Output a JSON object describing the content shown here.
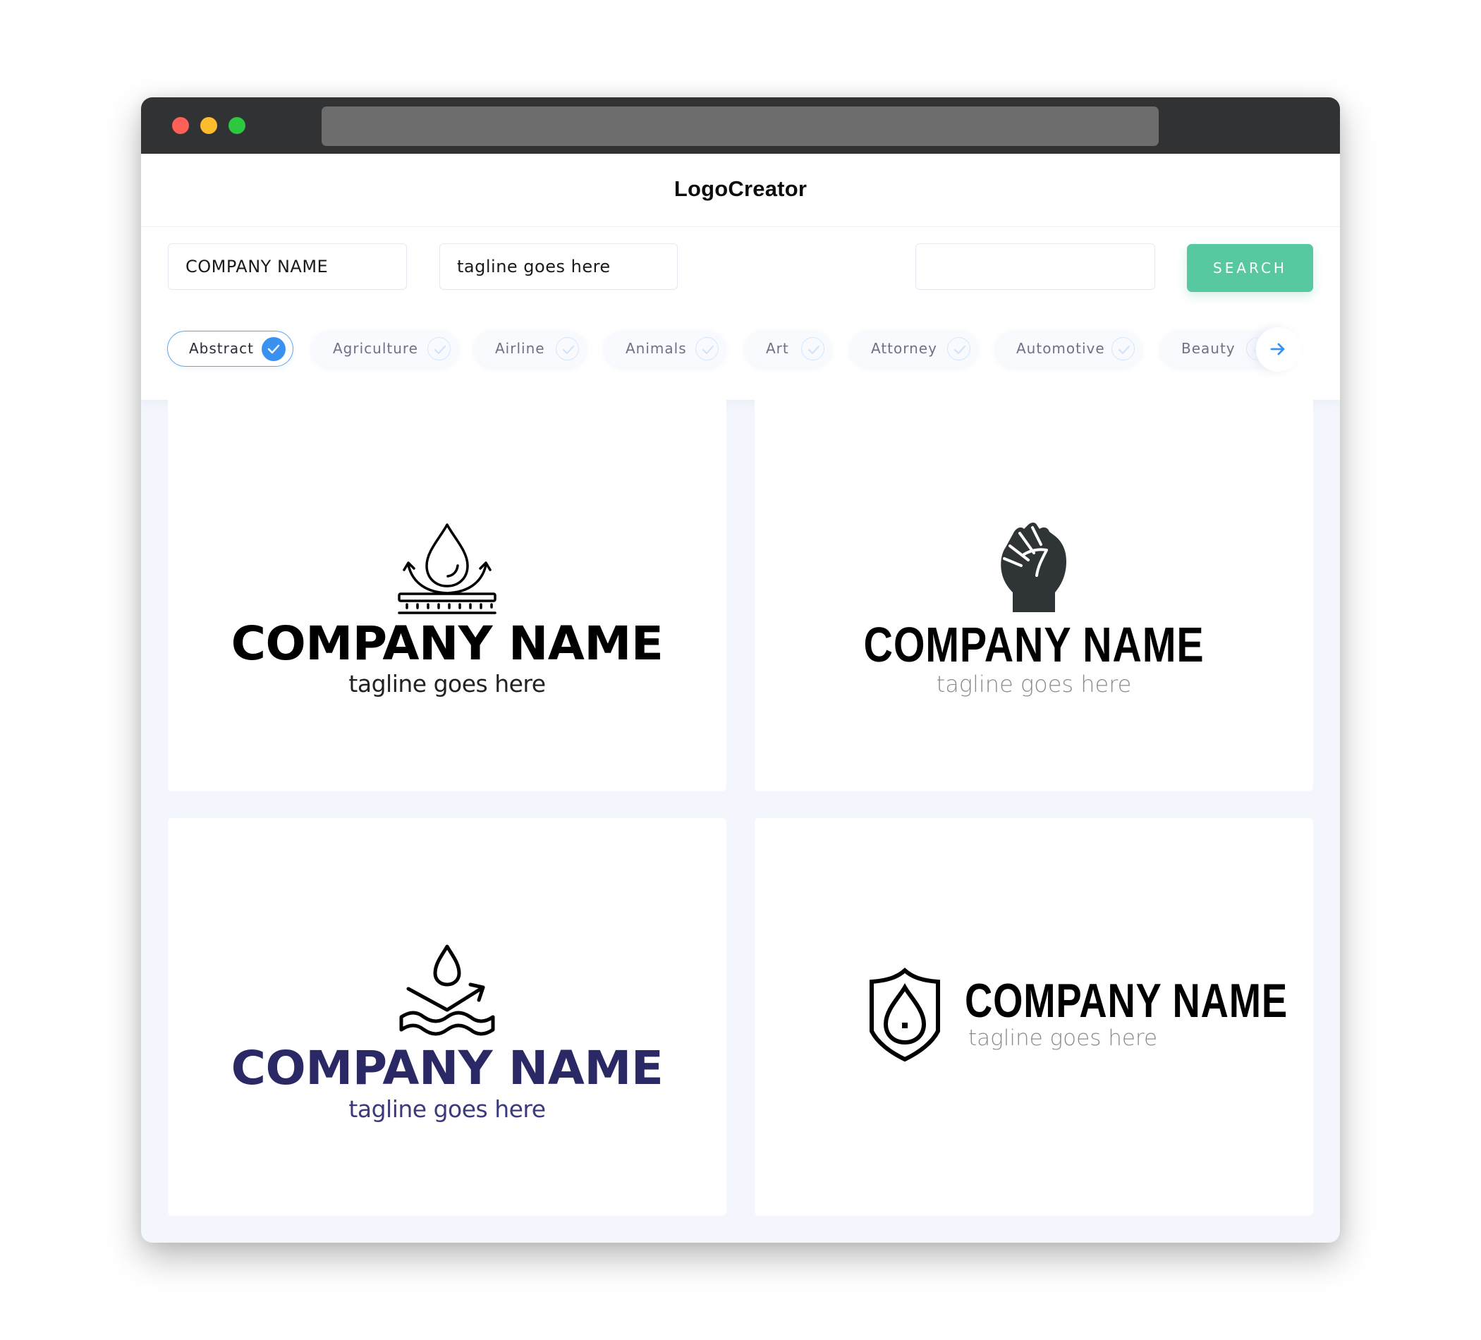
{
  "window": {
    "traffic_lights": [
      "close",
      "minimize",
      "maximize"
    ],
    "address_bar": ""
  },
  "header": {
    "brand": "LogoCreator"
  },
  "search": {
    "company_value": "COMPANY NAME",
    "tagline_value": "tagline goes here",
    "extra_value": "",
    "button_label": "SEARCH",
    "accent_color": "#58C8A0"
  },
  "categories": {
    "items": [
      {
        "label": "Abstract",
        "selected": true
      },
      {
        "label": "Agriculture",
        "selected": false
      },
      {
        "label": "Airline",
        "selected": false
      },
      {
        "label": "Animals",
        "selected": false
      },
      {
        "label": "Art",
        "selected": false
      },
      {
        "label": "Attorney",
        "selected": false
      },
      {
        "label": "Automotive",
        "selected": false
      },
      {
        "label": "Beauty",
        "selected": false
      }
    ],
    "next_icon": "arrow-right-icon",
    "selected_color": "#3A92F0"
  },
  "logos": [
    {
      "icon": "water-drop-repel-icon",
      "company": "COMPANY NAME",
      "tagline": "tagline goes here",
      "color": "#000000"
    },
    {
      "icon": "raised-fist-icon",
      "company": "COMPANY NAME",
      "tagline": "tagline goes here",
      "color": "#000000"
    },
    {
      "icon": "water-drop-wave-icon",
      "company": "COMPANY NAME",
      "tagline": "tagline goes here",
      "color": "#2A2966"
    },
    {
      "icon": "shield-drop-icon",
      "company": "COMPANY NAME",
      "tagline": "tagline goes here",
      "color": "#000000"
    }
  ]
}
